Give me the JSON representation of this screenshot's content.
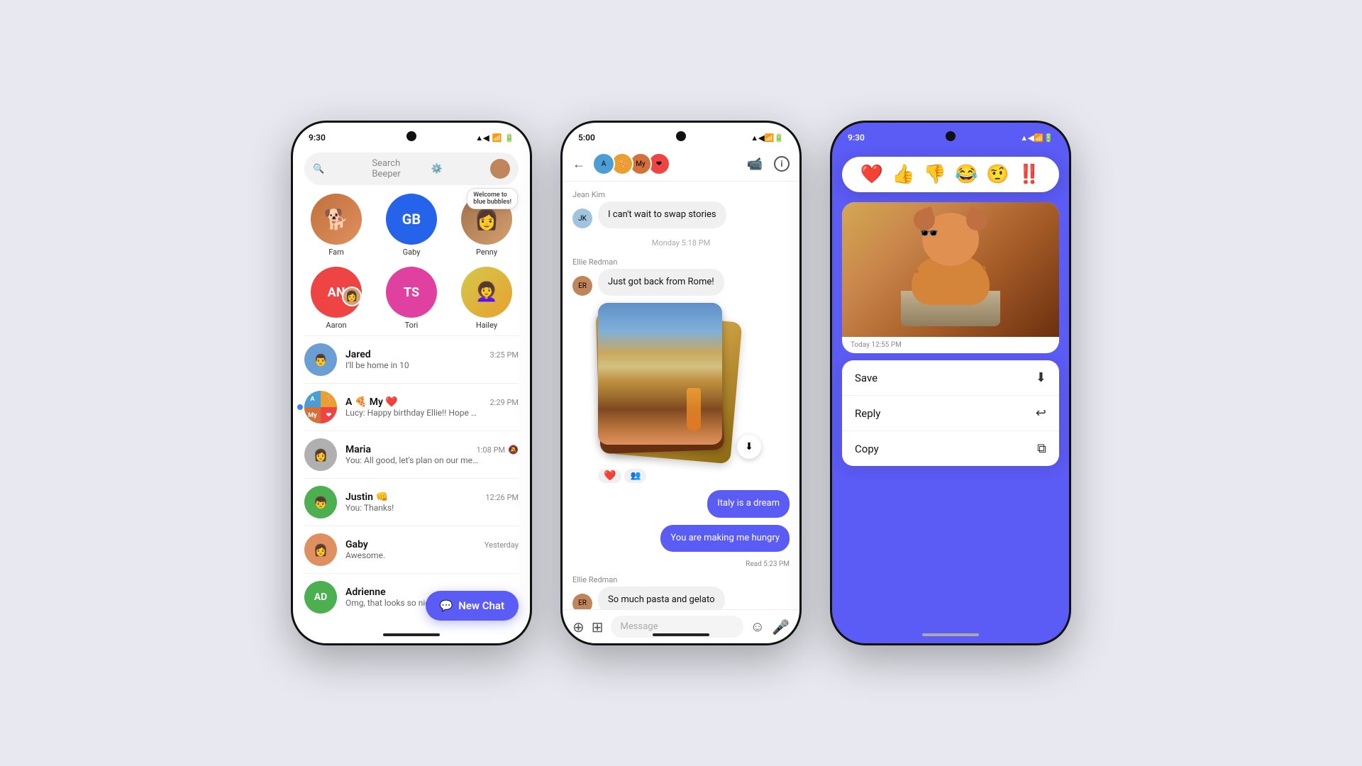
{
  "phone1": {
    "status_time": "9:30",
    "search_placeholder": "Search Beeper",
    "stories": [
      {
        "label": "Fam",
        "color": "#d4703a",
        "type": "avatar"
      },
      {
        "label": "Gaby",
        "color": "#2563eb",
        "initials": "GB"
      },
      {
        "label": "Penny",
        "color": "#c0855a",
        "type": "avatar",
        "has_dot": true,
        "welcome": "Welcome to\nblue bubbles!"
      }
    ],
    "stories2": [
      {
        "label": "Aaron",
        "color": "#ef4444",
        "initials": "AN",
        "has_dot": true
      },
      {
        "label": "Tori",
        "color": "#9c27b0",
        "initials": "TS"
      },
      {
        "label": "Hailey",
        "color": "#e8c878",
        "type": "avatar"
      }
    ],
    "chats": [
      {
        "name": "Jared",
        "preview": "I'll be home in 10",
        "time": "3:25 PM",
        "unread": false
      },
      {
        "name": "A 🍕 My ❤️",
        "preview": "Lucy: Happy birthday Ellie!! Hope you've had a lovely day 🙂",
        "time": "2:29 PM",
        "unread": true
      },
      {
        "name": "Maria",
        "preview": "You: All good, let's plan on our meeting cool?",
        "time": "1:08 PM",
        "unread": false
      },
      {
        "name": "Justin 👊",
        "preview": "You: Thanks!",
        "time": "12:26 PM",
        "unread": false
      },
      {
        "name": "Gaby",
        "preview": "Awesome.",
        "time": "Yesterday",
        "unread": false
      },
      {
        "name": "Adrienne",
        "preview": "Omg, that looks so nice!",
        "time": "",
        "unread": false
      }
    ],
    "new_chat_label": "New Chat"
  },
  "phone2": {
    "status_time": "5:00",
    "chat_title": "A 🍕 My ❤️",
    "messages": [
      {
        "sender": "Jean Kim",
        "text": "I can't wait to swap stories",
        "type": "received",
        "time": ""
      },
      {
        "timestamp": "Monday 5:18 PM"
      },
      {
        "sender": "Ellie Redman",
        "text": "Just got back from Rome!",
        "type": "received"
      },
      {
        "type": "image_stack"
      },
      {
        "text": "Italy is a dream",
        "type": "sent"
      },
      {
        "text": "You are making me hungry",
        "type": "sent"
      },
      {
        "read_receipt": "Read  5:23 PM"
      },
      {
        "sender": "Ellie Redman",
        "text": "So much pasta and gelato",
        "type": "received"
      }
    ],
    "input_placeholder": "Message"
  },
  "phone3": {
    "status_time": "9:30",
    "reactions": [
      "❤️",
      "👍",
      "👎",
      "😂",
      "🤨",
      "‼️"
    ],
    "photo_timestamp": "Today  12:55 PM",
    "context_menu": [
      {
        "label": "Save",
        "icon": "⬇"
      },
      {
        "label": "Reply",
        "icon": "↩"
      },
      {
        "label": "Copy",
        "icon": "⧉"
      }
    ]
  },
  "icons": {
    "search": "🔍",
    "gear": "⚙",
    "back": "←",
    "video": "📹",
    "info": "ⓘ",
    "plus": "＋",
    "gallery": "⊞",
    "emoji": "☺",
    "mic": "🎤",
    "download": "⬇",
    "chat_bubble": "💬"
  }
}
